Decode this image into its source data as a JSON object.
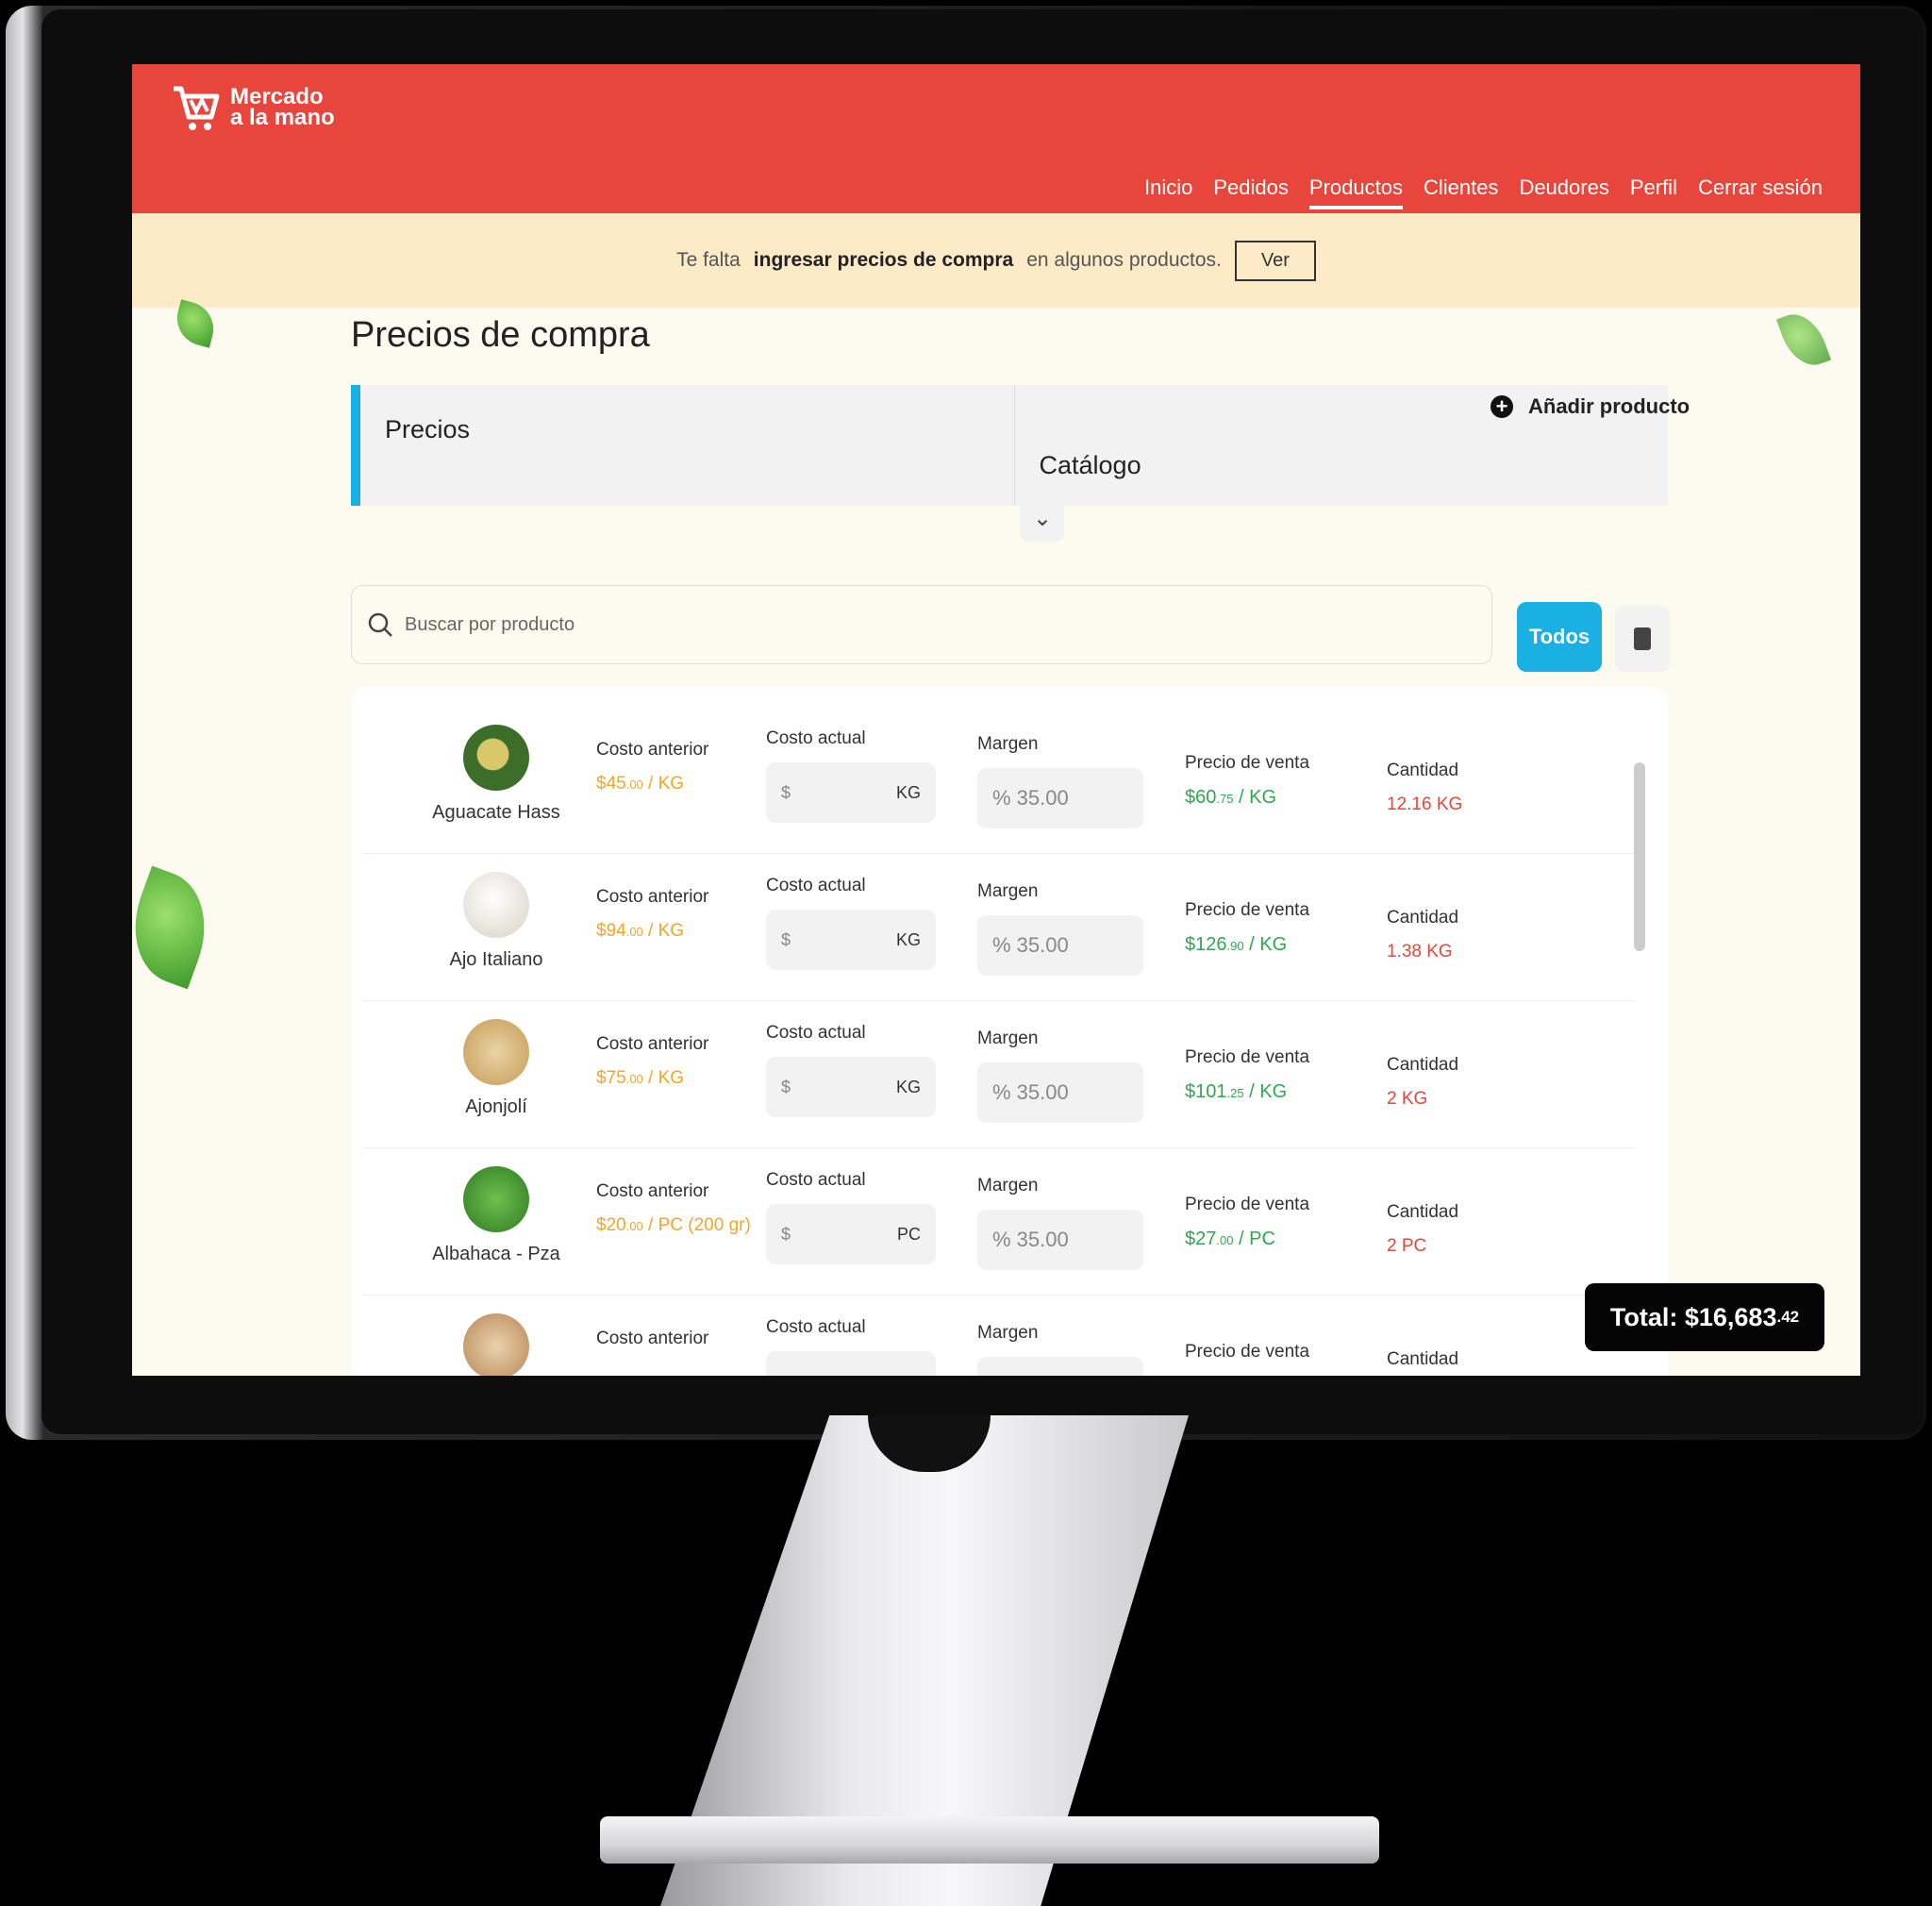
{
  "brand": {
    "line1": "Mercado",
    "line2": "a la mano"
  },
  "nav": [
    "Inicio",
    "Pedidos",
    "Productos",
    "Clientes",
    "Deudores",
    "Perfil",
    "Cerrar sesión"
  ],
  "notice": {
    "prefix": "Te falta",
    "bold": "ingresar precios de compra",
    "suffix": "en algunos productos.",
    "button": "Ver"
  },
  "page_title": "Precios de compra",
  "add_product": "Añadir producto",
  "tabs": [
    "Precios",
    "Catálogo"
  ],
  "search": {
    "placeholder": "Buscar por producto"
  },
  "filter_button": "Todos",
  "columns": {
    "prev": "Costo anterior",
    "current": "Costo actual",
    "margin": "Margen",
    "sale": "Precio de venta",
    "qty": "Cantidad"
  },
  "products": [
    {
      "name": "Aguacate Hass",
      "prev": "$45",
      "prev_cents": ".00",
      "prev_unit": " / KG",
      "cur_prefix": "$",
      "cur_unit": "KG",
      "margin": "% 35.00",
      "sale": "$60",
      "sale_cents": ".75",
      "sale_unit": " / KG",
      "qty": "12.16 KG",
      "color": "#3c6e2a"
    },
    {
      "name": "Ajo Italiano",
      "prev": "$94",
      "prev_cents": ".00",
      "prev_unit": " / KG",
      "cur_prefix": "$",
      "cur_unit": "KG",
      "margin": "% 35.00",
      "sale": "$126",
      "sale_cents": ".90",
      "sale_unit": " / KG",
      "qty": "1.38 KG",
      "color": "#e9e6de"
    },
    {
      "name": "Ajonjolí",
      "prev": "$75",
      "prev_cents": ".00",
      "prev_unit": " / KG",
      "cur_prefix": "$",
      "cur_unit": "KG",
      "margin": "% 35.00",
      "sale": "$101",
      "sale_cents": ".25",
      "sale_unit": " / KG",
      "qty": "2 KG",
      "color": "#d8bb82"
    },
    {
      "name": "Albahaca - Pza",
      "prev": "$20",
      "prev_cents": ".00",
      "prev_unit": " / PC (200 gr)",
      "cur_prefix": "$",
      "cur_unit": "PC",
      "margin": "% 35.00",
      "sale": "$27",
      "sale_cents": ".00",
      "sale_unit": " / PC",
      "qty": "2 PC",
      "color": "#4b9a3a"
    },
    {
      "name": "",
      "prev": "",
      "prev_cents": "",
      "prev_unit": "",
      "cur_prefix": "",
      "cur_unit": "",
      "margin": "",
      "sale": "",
      "sale_cents": "",
      "sale_unit": "",
      "qty": "",
      "color": "#c89b6a"
    }
  ],
  "total": {
    "label": "Total: $16,683",
    "cents": ".42"
  },
  "colors": {
    "brand_red": "#e8453c",
    "notice_bg": "#fcebc6",
    "accent_blue": "#1ab0e4",
    "price_orange": "#f6a623",
    "price_green": "#2fa84f"
  }
}
